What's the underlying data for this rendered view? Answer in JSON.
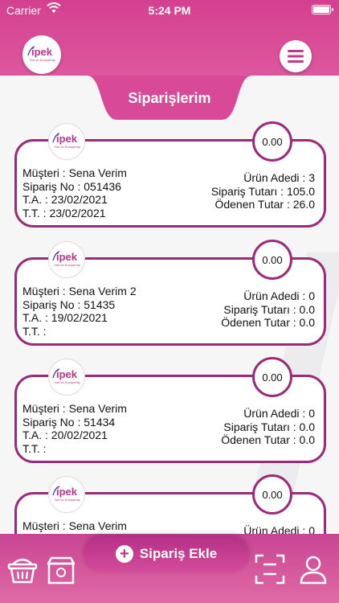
{
  "status_bar": {
    "carrier": "Carrier",
    "time": "5:24 PM"
  },
  "brand": {
    "logo_text": "ipek",
    "logo_sub": "Nut ve Kuruyemiş"
  },
  "page": {
    "title": "Siparişlerim"
  },
  "orders": [
    {
      "badge": "0.00",
      "musteri": "Müşteri : Sena Verim",
      "siparis_no": "Sipariş No : 051436",
      "ta": "T.A. : 23/02/2021",
      "tt": "T.T. : 23/02/2021",
      "urun_adedi": "Ürün Adedi : 3",
      "siparis_tutari": "Sipariş Tutarı : 105.0",
      "odenen_tutar": "Ödenen Tutar : 26.0"
    },
    {
      "badge": "0.00",
      "musteri": "Müşteri : Sena Verim 2",
      "siparis_no": "Sipariş No : 51435",
      "ta": "T.A. : 19/02/2021",
      "tt": "T.T. :",
      "urun_adedi": "Ürün Adedi : 0",
      "siparis_tutari": "Sipariş Tutarı : 0.0",
      "odenen_tutar": "Ödenen Tutar : 0.0"
    },
    {
      "badge": "0.00",
      "musteri": "Müşteri : Sena Verim",
      "siparis_no": "Sipariş No : 51434",
      "ta": "T.A. : 20/02/2021",
      "tt": "T.T. :",
      "urun_adedi": "Ürün Adedi : 0",
      "siparis_tutari": "Sipariş Tutarı : 0.0",
      "odenen_tutar": "Ödenen Tutar : 0.0"
    },
    {
      "badge": "0.00",
      "musteri": "Müşteri : Sena Verim",
      "urun_adedi": "Ürün Adedi : 0"
    }
  ],
  "bottom_bar": {
    "add_label": "Sipariş Ekle"
  },
  "icons": {
    "menu": "hamburger-menu-icon",
    "basket": "basket-icon",
    "box": "package-box-icon",
    "scan": "scan-frame-icon",
    "profile": "user-profile-icon"
  },
  "colors": {
    "primary": "#d4408f",
    "border": "#9b2b78"
  }
}
